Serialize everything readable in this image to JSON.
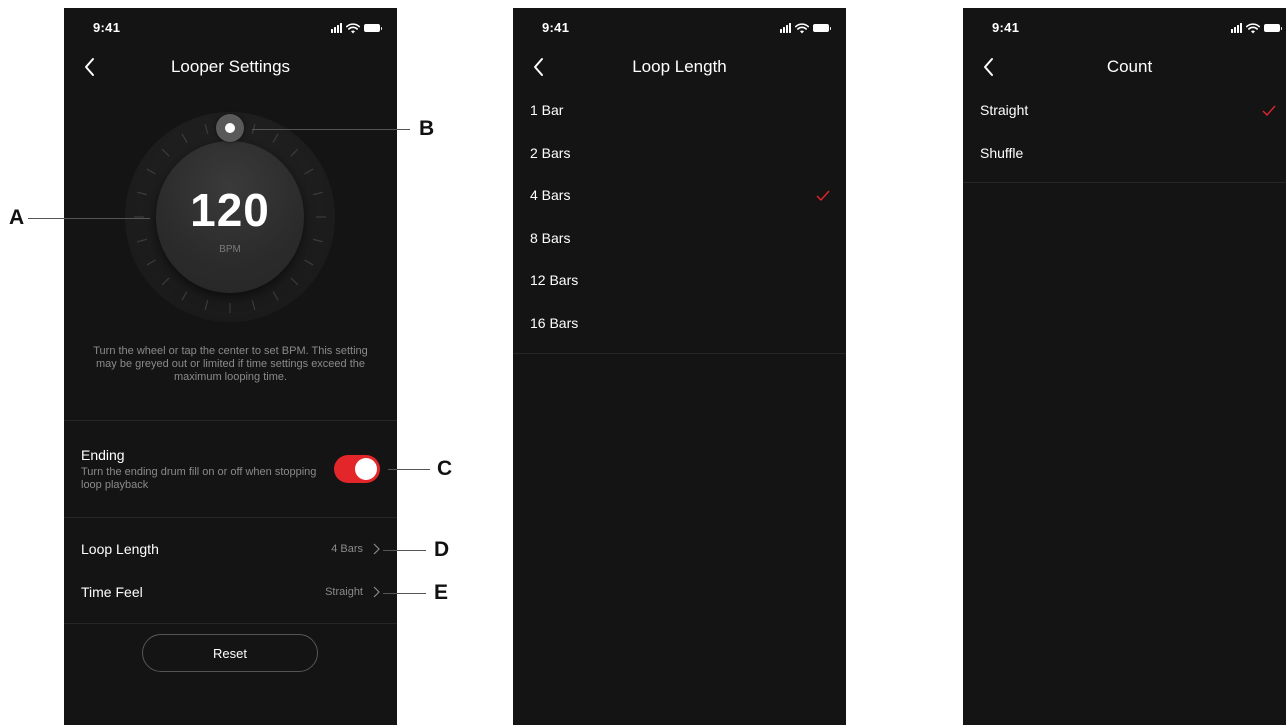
{
  "colors": {
    "accent": "#e3262a",
    "background": "#141414",
    "text": "#ffffff",
    "muted": "#8a8a8a"
  },
  "statusbar": {
    "time": "9:41"
  },
  "looper": {
    "title": "Looper Settings",
    "bpm_value": "120",
    "bpm_unit": "BPM",
    "help_text": "Turn the wheel or tap the center to set BPM. This setting may be greyed out or limited if time settings exceed the maximum looping time.",
    "ending_title": "Ending",
    "ending_description": "Turn the ending drum fill on or off when stopping loop playback",
    "ending_enabled": true,
    "loop_length_label": "Loop Length",
    "loop_length_value": "4 Bars",
    "time_feel_label": "Time Feel",
    "time_feel_value": "Straight",
    "reset_label": "Reset"
  },
  "loop_length": {
    "title": "Loop Length",
    "options": [
      "1 Bar",
      "2 Bars",
      "4 Bars",
      "8 Bars",
      "12 Bars",
      "16 Bars"
    ],
    "selected": "4 Bars"
  },
  "count": {
    "title": "Count",
    "options": [
      "Straight",
      "Shuffle"
    ],
    "selected": "Straight"
  },
  "callouts": {
    "a": "A",
    "b": "B",
    "c": "C",
    "d": "D",
    "e": "E"
  }
}
